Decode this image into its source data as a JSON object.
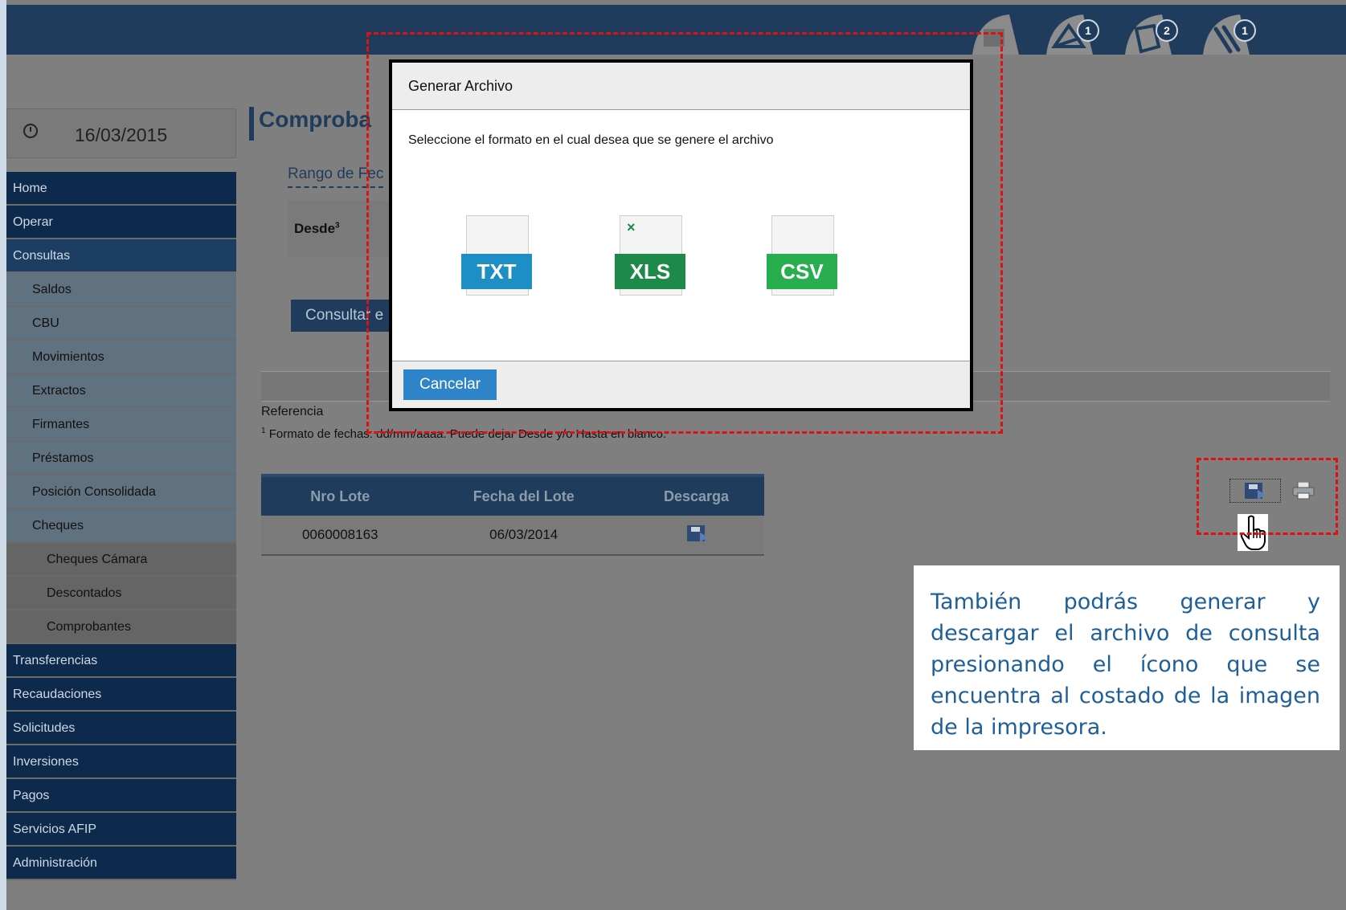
{
  "session": {
    "date": "16/03/2015"
  },
  "header": {
    "badges": [
      "1",
      "2",
      "1"
    ]
  },
  "menu": [
    {
      "label": "Home",
      "level": 1
    },
    {
      "label": "Operar",
      "level": 1
    },
    {
      "label": "Consultas",
      "level": 1,
      "active": true
    },
    {
      "label": "Saldos",
      "level": 2
    },
    {
      "label": "CBU",
      "level": 2
    },
    {
      "label": "Movimientos",
      "level": 2
    },
    {
      "label": "Extractos",
      "level": 2
    },
    {
      "label": "Firmantes",
      "level": 2
    },
    {
      "label": "Préstamos",
      "level": 2
    },
    {
      "label": "Posición Consolidada",
      "level": 2
    },
    {
      "label": "Cheques",
      "level": 2
    },
    {
      "label": "Cheques Cámara",
      "level": 3
    },
    {
      "label": "Descontados",
      "level": 3
    },
    {
      "label": "Comprobantes",
      "level": 3
    },
    {
      "label": "Transferencias",
      "level": 1
    },
    {
      "label": "Recaudaciones",
      "level": 1
    },
    {
      "label": "Solicitudes",
      "level": 1
    },
    {
      "label": "Inversiones",
      "level": 1
    },
    {
      "label": "Pagos",
      "level": 1
    },
    {
      "label": "Servicios AFIP",
      "level": 1
    },
    {
      "label": "Administración",
      "level": 1
    }
  ],
  "main": {
    "title": "Comproba",
    "range_link": "Rango de Fec",
    "desde_label": "Desde",
    "desde_sup": "3",
    "consultar_button": "Consultar e",
    "referencia": "Referencia",
    "footnote_sup": "1",
    "footnote": "Formato de fechas: dd/mm/aaaa. Puede dejar Desde y/o Hasta en blanco."
  },
  "table": {
    "headers": [
      "Nro Lote",
      "Fecha del Lote",
      "Descarga"
    ],
    "rows": [
      [
        "0060008163",
        "06/03/2014"
      ]
    ]
  },
  "modal": {
    "title": "Generar Archivo",
    "message": "Seleccione el formato en el cual desea que se genere el archivo",
    "formats": [
      {
        "label": "TXT",
        "color": "#1e8fc4"
      },
      {
        "label": "XLS",
        "color": "#1e8a4a"
      },
      {
        "label": "CSV",
        "color": "#28ad4f"
      }
    ],
    "cancel_button": "Cancelar"
  },
  "callout": "También podrás generar y descargar el archivo de consulta presionando el ícono que se encuentra al costado de la imagen de la impresora.",
  "colors": {
    "highlight": "#e01010",
    "navy": "#1f3c5d"
  }
}
